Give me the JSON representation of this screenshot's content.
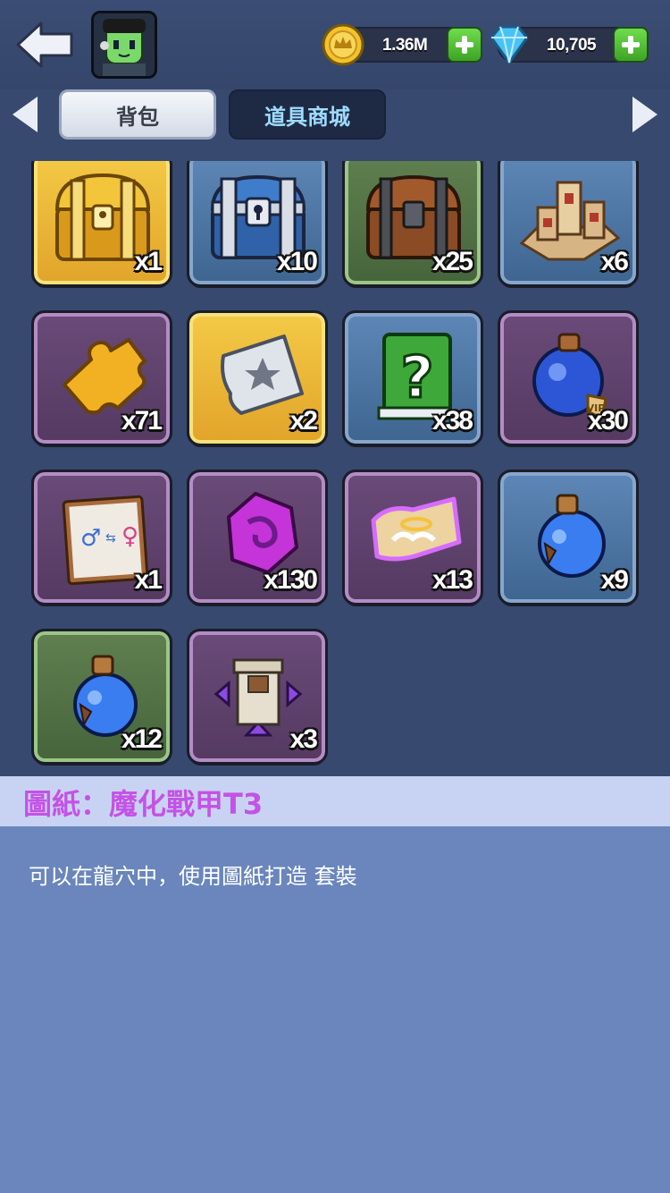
{
  "header": {
    "gold_amount": "1.36M",
    "gem_amount": "10,705"
  },
  "tabs": [
    {
      "label": "背包",
      "active": true
    },
    {
      "label": "道具商城",
      "active": false
    }
  ],
  "items": [
    {
      "name": "gold-chest",
      "count": "x1",
      "frame": "gold"
    },
    {
      "name": "silver-chest",
      "count": "x10",
      "frame": "blue"
    },
    {
      "name": "wooden-chest",
      "count": "x25",
      "frame": "green"
    },
    {
      "name": "castle",
      "count": "x6",
      "frame": "blue"
    },
    {
      "name": "puzzle-piece",
      "count": "x71",
      "frame": "purple"
    },
    {
      "name": "star-ticket",
      "count": "x2",
      "frame": "gold"
    },
    {
      "name": "mystery-book",
      "count": "x38",
      "frame": "blue"
    },
    {
      "name": "vip-potion",
      "count": "x30",
      "frame": "purple"
    },
    {
      "name": "gender-swap-scroll",
      "count": "x1",
      "frame": "purple"
    },
    {
      "name": "purple-gem",
      "count": "x130",
      "frame": "purple"
    },
    {
      "name": "angel-scroll",
      "count": "x13",
      "frame": "purple"
    },
    {
      "name": "blue-potion",
      "count": "x9",
      "frame": "blue"
    },
    {
      "name": "blue-potion-small",
      "count": "x12",
      "frame": "green"
    },
    {
      "name": "tower-upgrade",
      "count": "x3",
      "frame": "purple"
    }
  ],
  "detail": {
    "title": "圖紙：魔化戰甲T3",
    "description": "可以在龍穴中，使用圖紙打造 套裝"
  },
  "colors": {
    "background": "#37496e",
    "detail_title": "#c552e6",
    "detail_panel": "#6a86bd"
  }
}
